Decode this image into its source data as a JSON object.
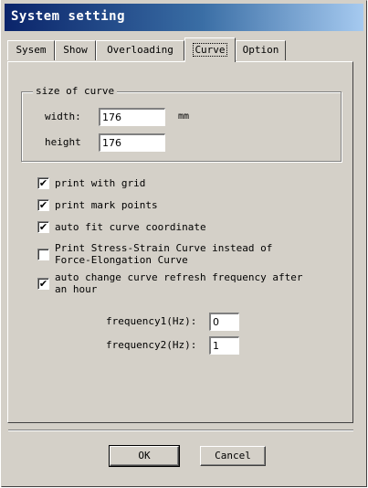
{
  "window": {
    "title": "System setting"
  },
  "tabs": [
    {
      "label": "Sysem",
      "active": false
    },
    {
      "label": "Show",
      "active": false
    },
    {
      "label": "Overloading",
      "active": false
    },
    {
      "label": "Curve",
      "active": true
    },
    {
      "label": "Option",
      "active": false
    }
  ],
  "size_group": {
    "legend": "size of curve",
    "width_label": "width:",
    "width_value": "176",
    "unit": "mm",
    "height_label": "height",
    "height_value": "176"
  },
  "checkboxes": [
    {
      "label": "print with grid",
      "checked": true,
      "check_mark": "✔"
    },
    {
      "label": "print mark points",
      "checked": true,
      "check_mark": "✔"
    },
    {
      "label": "auto fit curve coordinate",
      "checked": true,
      "check_mark": "✔"
    },
    {
      "label_line1": "Print Stress-Strain Curve instead of",
      "label_line2": "Force-Elongation Curve",
      "checked": false,
      "check_mark": ""
    },
    {
      "label_line1": "auto change curve refresh frequency after",
      "label_line2": "an hour",
      "checked": true,
      "check_mark": "✔"
    }
  ],
  "frequency": {
    "f1_label": "frequency1(Hz):",
    "f1_value": "0",
    "f2_label": "frequency2(Hz):",
    "f2_value": "1"
  },
  "buttons": {
    "ok": "OK",
    "cancel": "Cancel"
  }
}
